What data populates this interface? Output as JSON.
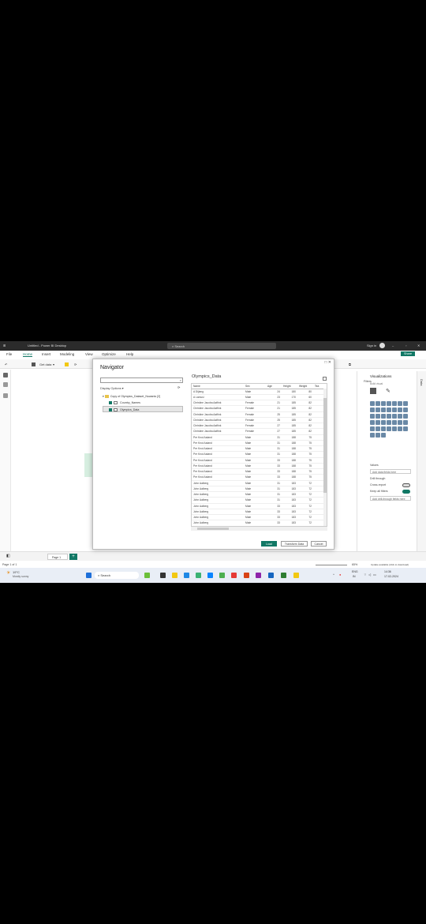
{
  "window": {
    "title": "Untitled - Power BI Desktop",
    "search_placeholder": "Search",
    "sign_in": "Sign in",
    "share": "Share"
  },
  "menu": {
    "items": [
      "File",
      "Home",
      "Insert",
      "Modeling",
      "View",
      "Optimize",
      "Help"
    ]
  },
  "ribbon": {
    "get_data": "Get data"
  },
  "navigator": {
    "title": "Navigator",
    "display_options": "Display Options",
    "tree": [
      {
        "label": "Copy of Olympics_Dataset_Nuwanis [2]",
        "type": "folder",
        "checked": false
      },
      {
        "label": "Country_Names",
        "type": "table",
        "checked": true
      },
      {
        "label": "Olympics_Data",
        "type": "table",
        "checked": true
      }
    ],
    "preview_title": "Olympics_Data",
    "columns": [
      "Name",
      "Sex",
      "Age",
      "Height",
      "Weight",
      "Tea"
    ],
    "rows": [
      [
        "A Dijiang",
        "Male",
        "24",
        "180",
        "80",
        ""
      ],
      [
        "A Lamusi",
        "Male",
        "23",
        "170",
        "60",
        ""
      ],
      [
        "Christine Jacoba Aaftink",
        "Female",
        "21",
        "185",
        "82",
        ""
      ],
      [
        "Christine Jacoba Aaftink",
        "Female",
        "21",
        "185",
        "82",
        ""
      ],
      [
        "Christine Jacoba Aaftink",
        "Female",
        "25",
        "185",
        "82",
        ""
      ],
      [
        "Christine Jacoba Aaftink",
        "Female",
        "25",
        "185",
        "82",
        ""
      ],
      [
        "Christine Jacoba Aaftink",
        "Female",
        "27",
        "185",
        "82",
        ""
      ],
      [
        "Christine Jacoba Aaftink",
        "Female",
        "27",
        "185",
        "82",
        ""
      ],
      [
        "Per Knut Aaland",
        "Male",
        "31",
        "188",
        "75",
        ""
      ],
      [
        "Per Knut Aaland",
        "Male",
        "31",
        "188",
        "75",
        ""
      ],
      [
        "Per Knut Aaland",
        "Male",
        "31",
        "188",
        "75",
        ""
      ],
      [
        "Per Knut Aaland",
        "Male",
        "31",
        "188",
        "75",
        ""
      ],
      [
        "Per Knut Aaland",
        "Male",
        "33",
        "188",
        "75",
        ""
      ],
      [
        "Per Knut Aaland",
        "Male",
        "33",
        "188",
        "75",
        ""
      ],
      [
        "Per Knut Aaland",
        "Male",
        "33",
        "188",
        "75",
        ""
      ],
      [
        "Per Knut Aaland",
        "Male",
        "33",
        "188",
        "75",
        ""
      ],
      [
        "John Aalberg",
        "Male",
        "31",
        "183",
        "72",
        ""
      ],
      [
        "John Aalberg",
        "Male",
        "31",
        "183",
        "72",
        ""
      ],
      [
        "John Aalberg",
        "Male",
        "31",
        "183",
        "72",
        ""
      ],
      [
        "John Aalberg",
        "Male",
        "31",
        "183",
        "72",
        ""
      ],
      [
        "John Aalberg",
        "Male",
        "33",
        "183",
        "72",
        ""
      ],
      [
        "John Aalberg",
        "Male",
        "33",
        "183",
        "72",
        ""
      ],
      [
        "John Aalberg",
        "Male",
        "33",
        "183",
        "72",
        ""
      ],
      [
        "John Aalberg",
        "Male",
        "33",
        "183",
        "72",
        ""
      ]
    ],
    "buttons": {
      "load": "Load",
      "transform": "Transform Data",
      "cancel": "Cancel"
    }
  },
  "visualizations": {
    "title": "Visualizations",
    "build_visual": "Build visual",
    "values_label": "Values",
    "values_placeholder": "Add data fields here",
    "drill_through": "Drill through",
    "cross_report": "Cross-report",
    "keep_all_filters": "Keep all filters",
    "drill_placeholder": "Add drill-through fields here",
    "data_tab": "Data",
    "filters_tab": "Filters"
  },
  "pages": {
    "tab": "Page 1",
    "status": "Page 1 of 1",
    "zoom": "65%",
    "update_notice": "Update available (click to download)"
  },
  "taskbar": {
    "weather_temp": "19°C",
    "weather_desc": "Mostly sunny",
    "search": "Search",
    "lang": "ENG",
    "region": "IN",
    "time": "14:36",
    "date": "17-02-2024"
  },
  "colors": {
    "accent": "#117865",
    "titlebar": "#2b2b2b"
  }
}
